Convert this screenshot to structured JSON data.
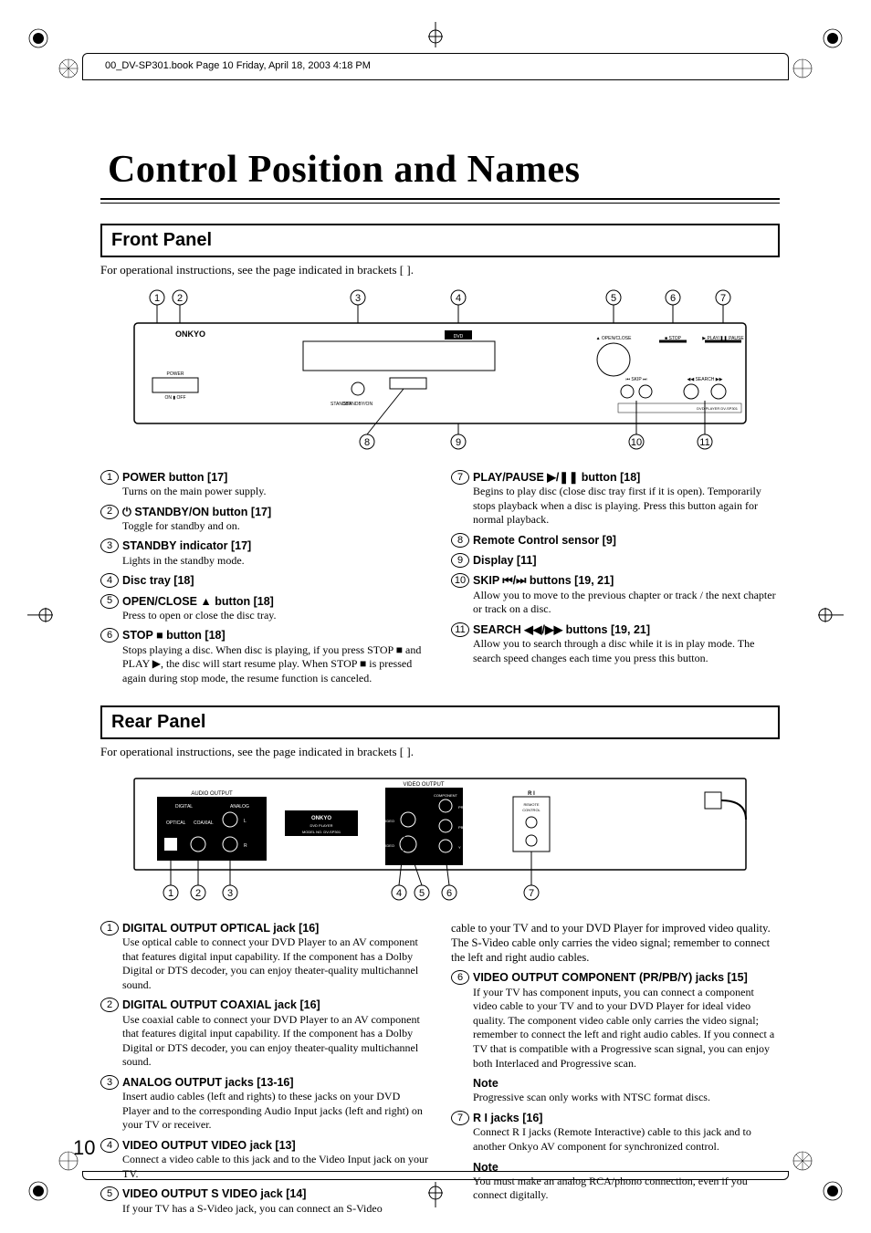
{
  "header_line": "00_DV-SP301.book  Page 10  Friday, April 18, 2003  4:18 PM",
  "title": "Control Position and Names",
  "page_number": "10",
  "front_panel": {
    "heading": "Front Panel",
    "instruction": "For operational instructions, see the page indicated in brackets [  ].",
    "callout_top": [
      "1",
      "2",
      "3",
      "4",
      "5",
      "6",
      "7"
    ],
    "callout_bottom": [
      "8",
      "9",
      "10",
      "11"
    ],
    "brand": "ONKYO",
    "model": "DVD PLAYER DV-SP301",
    "labels": {
      "power": "POWER",
      "on_off": "ON  OFF",
      "standby": "STANDBY",
      "standby_on": "STANDBY/ON",
      "open_close": "OPEN/CLOSE",
      "stop": "STOP",
      "play_pause": "PLAY/PAUSE",
      "skip_search": "SKIP  SEARCH"
    },
    "items_left": [
      {
        "n": "1",
        "title": "POWER button [17]",
        "desc": "Turns on the main power supply."
      },
      {
        "n": "2",
        "title": "STANDBY/ON button [17]",
        "title_prefix_icon": "power-icon",
        "desc": "Toggle for standby and on."
      },
      {
        "n": "3",
        "title": "STANDBY indicator [17]",
        "desc": "Lights in the standby mode."
      },
      {
        "n": "4",
        "title": "Disc tray [18]",
        "desc": ""
      },
      {
        "n": "5",
        "title": "OPEN/CLOSE ▲ button [18]",
        "desc": "Press to open or close the disc tray."
      },
      {
        "n": "6",
        "title": "STOP ■ button [18]",
        "desc": "Stops playing a disc. When disc is playing, if you press STOP ■ and PLAY ▶, the disc will start resume play. When STOP ■ is pressed again during stop mode, the resume function is canceled."
      }
    ],
    "items_right": [
      {
        "n": "7",
        "title": "PLAY/PAUSE ▶/❚❚ button [18]",
        "desc": "Begins to play disc (close disc tray first if it is open). Temporarily stops playback when a disc is playing. Press this button again for normal playback."
      },
      {
        "n": "8",
        "title": "Remote Control sensor [9]",
        "desc": ""
      },
      {
        "n": "9",
        "title": "Display [11]",
        "desc": ""
      },
      {
        "n": "10",
        "title": "SKIP ⏮/⏭ buttons [19, 21]",
        "desc": "Allow you to move to the previous chapter or track / the next chapter or track on a disc."
      },
      {
        "n": "11",
        "title": "SEARCH ◀◀/▶▶ buttons [19, 21]",
        "desc": "Allow you to search through a disc while it is in play mode. The search speed changes each time you press this button."
      }
    ]
  },
  "rear_panel": {
    "heading": "Rear Panel",
    "instruction": "For operational instructions, see the page indicated in brackets [  ].",
    "callouts": [
      "1",
      "2",
      "3",
      "4",
      "5",
      "6",
      "7"
    ],
    "labels": {
      "audio_output": "AUDIO OUTPUT",
      "digital": "DIGITAL",
      "analog": "ANALOG",
      "optical": "OPTICAL",
      "coaxial": "COAXIAL",
      "l": "L",
      "r": "R",
      "video_output": "VIDEO OUTPUT",
      "component": "COMPONENT",
      "video": "VIDEO",
      "svideo": "S VIDEO",
      "pr": "PR",
      "pb": "PB",
      "y": "Y",
      "ri": "R I",
      "remote_control": "REMOTE CONTROL",
      "brand": "ONKYO",
      "dvd_player": "DVD PLAYER",
      "model_no": "MODEL NO. DV-SP301"
    },
    "items_left": [
      {
        "n": "1",
        "title": "DIGITAL OUTPUT OPTICAL jack [16]",
        "desc": "Use optical cable to connect your DVD Player to an AV component that features digital input capability. If the component has a Dolby Digital or DTS decoder, you can enjoy theater-quality multichannel sound."
      },
      {
        "n": "2",
        "title": "DIGITAL OUTPUT COAXIAL jack [16]",
        "desc": "Use coaxial cable to connect your DVD Player to an AV component that features digital input capability. If the component has a Dolby Digital or DTS decoder, you can enjoy theater-quality multichannel sound."
      },
      {
        "n": "3",
        "title": "ANALOG OUTPUT jacks [13-16]",
        "desc": "Insert audio cables (left and rights) to these jacks on your DVD Player and to the corresponding Audio Input jacks (left and right) on your TV or receiver."
      },
      {
        "n": "4",
        "title": "VIDEO OUTPUT VIDEO jack [13]",
        "desc": "Connect a video cable to this jack and to the Video Input jack on your TV."
      },
      {
        "n": "5",
        "title": "VIDEO OUTPUT S VIDEO jack [14]",
        "desc": "If your TV has a S-Video jack, you can connect an S-Video"
      }
    ],
    "right_lead_desc": "cable to your TV and to your DVD Player for improved video quality. The S-Video cable only carries the video signal; remember to connect the left and right audio cables.",
    "items_right": [
      {
        "n": "6",
        "title": "VIDEO OUTPUT COMPONENT (PR/PB/Y) jacks [15]",
        "desc": "If your TV has component inputs, you can connect a component video cable to your TV and to your DVD Player for ideal video quality. The component video cable only carries the video signal; remember to connect the left and right audio cables. If you connect a TV that is compatible with a Progressive scan signal, you can enjoy both Interlaced and Progressive scan.",
        "note": "Progressive scan only works with NTSC format discs."
      },
      {
        "n": "7",
        "title": "R I jacks [16]",
        "title_prefix_icon": "ri-icon",
        "desc": "Connect R I jacks (Remote Interactive) cable to this jack and to another Onkyo AV component for synchronized control.",
        "note": "You must make an analog RCA/phono connection, even if you connect digitally."
      }
    ],
    "note_label": "Note"
  }
}
